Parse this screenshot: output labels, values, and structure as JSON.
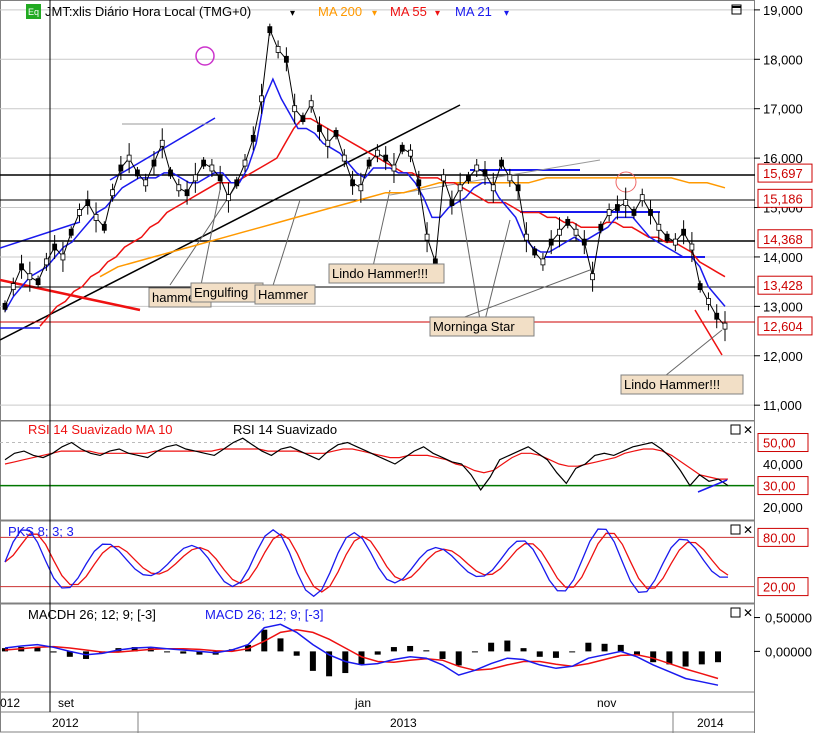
{
  "header": {
    "badge": "Eq",
    "symbol": "JMT:xlis Diário Hora Local (TMG+0)",
    "ma200": "MA 200",
    "ma55": "MA 55",
    "ma21": "MA 21",
    "caret": "▾"
  },
  "colors": {
    "price": "#000000",
    "ma200": "#ff9900",
    "ma55": "#ee1111",
    "ma21": "#1a1aee",
    "grid": "#c9c9c9",
    "badge": "#22aa22",
    "label_bg": "#f2dfc6",
    "line30": "#007700"
  },
  "annotations": {
    "hammer1": "hammer",
    "engulfing": "Engulfing",
    "hammer2": "Hammer",
    "lindo1": "Lindo Hammer!!!",
    "morninga": "Morninga Star",
    "lindo2": "Lindo Hammer!!!"
  },
  "rsi_panel": {
    "title1": "RSI 14 Suavizado MA 10",
    "title2": "RSI 14 Suavizado",
    "ticks": [
      "50,00",
      "40,000",
      "30,00",
      "20,000"
    ]
  },
  "pks_panel": {
    "title": "PKS 8; 3; 3",
    "ticks": [
      "80,00",
      "20,00"
    ]
  },
  "macd_panel": {
    "title1": "MACDH 26; 12; 9; [-3]",
    "title2": "MACD 26; 12; 9; [-3]",
    "ticks": [
      "0,50000",
      "0,00000"
    ]
  },
  "x_axis": {
    "top": [
      "012",
      "set",
      "jan",
      "nov"
    ],
    "bottom": [
      "2012",
      "2013",
      "2014"
    ]
  },
  "panel_icons": [
    "close-icon",
    "maximize-icon"
  ],
  "chart_data": {
    "type": "line",
    "title": "JMT:xlis Diário Hora Local (TMG+0)",
    "price_axis": {
      "ticks": [
        "19,000",
        "18,000",
        "17,000",
        "16,000",
        "15,000",
        "14,000",
        "13,000",
        "12,000",
        "11,000"
      ],
      "ylim": [
        10.7,
        19.2
      ],
      "marked_levels": [
        "15,697",
        "15,186",
        "14,368",
        "13,428",
        "12,604"
      ]
    },
    "x_labels": [
      "set",
      "jan",
      "nov"
    ],
    "year_labels": [
      "2012",
      "2013",
      "2014"
    ],
    "price_series": [
      {
        "name": "price",
        "values": [
          13.0,
          13.4,
          13.8,
          13.6,
          13.5,
          13.9,
          14.2,
          14.0,
          14.5,
          14.9,
          15.1,
          14.8,
          14.6,
          15.3,
          15.8,
          16.0,
          15.7,
          15.5,
          15.9,
          16.3,
          15.7,
          15.4,
          15.3,
          15.6,
          15.9,
          15.8,
          15.6,
          15.2,
          15.5,
          15.9,
          16.4,
          17.2,
          18.6,
          18.2,
          18.0,
          17.0,
          16.8,
          17.1,
          16.6,
          16.3,
          16.5,
          16.0,
          15.5,
          15.4,
          15.9,
          16.1,
          16.0,
          15.8,
          16.2,
          16.1,
          15.5,
          14.4,
          13.9,
          15.6,
          15.1,
          15.4,
          15.6,
          15.8,
          15.7,
          15.4,
          15.9,
          15.6,
          15.4,
          14.4,
          14.1,
          13.9,
          14.3,
          14.5,
          14.7,
          14.5,
          14.3,
          13.6,
          14.6,
          14.9,
          15.0,
          15.1,
          14.9,
          15.2,
          14.9,
          14.6,
          14.4,
          14.3,
          14.5,
          14.2,
          13.4,
          13.1,
          12.8,
          12.6
        ]
      },
      {
        "name": "MA 21",
        "values": [
          12.9,
          13.2,
          13.4,
          13.6,
          13.7,
          13.8,
          14.0,
          14.2,
          14.3,
          14.5,
          14.7,
          14.9,
          15.0,
          15.2,
          15.4,
          15.5,
          15.6,
          15.6,
          15.6,
          15.7,
          15.7,
          15.6,
          15.5,
          15.5,
          15.6,
          15.7,
          15.7,
          15.5,
          15.5,
          15.8,
          16.3,
          17.2,
          17.6,
          17.2,
          16.9,
          16.6,
          16.6,
          16.5,
          16.3,
          16.2,
          16.1,
          15.9,
          15.7,
          15.6,
          15.8,
          15.8,
          15.8,
          15.7,
          15.7,
          15.5,
          15.2,
          14.8,
          14.8,
          15.0,
          15.1,
          15.2,
          15.4,
          15.5,
          15.5,
          15.2,
          15.0,
          14.8,
          14.4,
          14.2,
          14.1,
          14.1,
          14.2,
          14.3,
          14.4,
          14.3,
          14.4,
          14.5,
          14.6,
          14.8,
          14.8,
          14.8,
          14.6,
          14.4,
          14.3,
          14.2,
          14.1,
          14.0,
          14.0,
          13.8,
          13.4,
          13.2,
          13.0
        ]
      },
      {
        "name": "MA 55",
        "values": [
          12.6,
          12.8,
          13.0,
          13.1,
          13.3,
          13.4,
          13.6,
          13.7,
          13.9,
          14.0,
          14.2,
          14.3,
          14.4,
          14.6,
          14.7,
          14.9,
          15.0,
          15.1,
          15.2,
          15.3,
          15.4,
          15.5,
          15.5,
          15.5,
          15.6,
          15.7,
          15.8,
          15.9,
          16.0,
          16.3,
          16.6,
          16.8,
          16.8,
          16.7,
          16.6,
          16.5,
          16.4,
          16.3,
          16.2,
          16.1,
          16.0,
          15.9,
          15.8,
          15.7,
          15.7,
          15.6,
          15.6,
          15.6,
          15.5,
          15.5,
          15.4,
          15.3,
          15.2,
          15.1,
          15.1,
          15.1,
          15.0,
          14.9,
          14.9,
          14.9,
          14.8,
          14.8,
          14.7,
          14.7,
          14.6,
          14.6,
          14.6,
          14.7,
          14.7,
          14.6,
          14.6,
          14.5,
          14.4,
          14.4,
          14.3,
          14.3,
          14.2,
          14.1,
          13.9,
          13.8,
          13.7,
          13.6
        ]
      },
      {
        "name": "MA 200",
        "values": [
          13.6,
          13.8,
          13.9,
          14.0,
          14.1,
          14.2,
          14.3,
          14.4,
          14.5,
          14.6,
          14.7,
          14.8,
          14.9,
          15.0,
          15.1,
          15.2,
          15.3,
          15.3,
          15.4,
          15.5,
          15.5,
          15.5,
          15.5,
          15.5,
          15.5,
          15.6,
          15.6,
          15.6,
          15.6,
          15.6,
          15.6,
          15.6,
          15.6,
          15.5,
          15.5,
          15.4
        ]
      }
    ],
    "rsi_series": [
      {
        "name": "RSI 14 Suavizado",
        "values": [
          42,
          45,
          46,
          44,
          43,
          45,
          48,
          50,
          47,
          45,
          44,
          46,
          47,
          45,
          44,
          43,
          46,
          48,
          49,
          47,
          46,
          45,
          44,
          47,
          50,
          52,
          49,
          46,
          44,
          47,
          48,
          46,
          44,
          42,
          46,
          49,
          50,
          48,
          46,
          44,
          42,
          40,
          43,
          46,
          48,
          45,
          43,
          41,
          40,
          35,
          28,
          34,
          42,
          44,
          46,
          48,
          45,
          42,
          36,
          31,
          38,
          40,
          44,
          45,
          44,
          46,
          48,
          49,
          50,
          47,
          43,
          37,
          30,
          35,
          32,
          33,
          30
        ]
      },
      {
        "name": "RSI 14 Suavizado MA 10",
        "values": [
          40,
          41,
          42,
          43,
          44,
          45,
          46,
          46,
          46,
          46,
          45,
          45,
          45,
          45,
          45,
          45,
          46,
          46,
          46,
          46,
          46,
          46,
          46,
          47,
          47,
          47,
          47,
          47,
          46,
          46,
          46,
          46,
          45,
          45,
          45,
          46,
          47,
          47,
          46,
          45,
          44,
          43,
          43,
          44,
          44,
          44,
          43,
          42,
          40,
          39,
          37,
          36,
          37,
          40,
          43,
          45,
          45,
          44,
          42,
          40,
          39,
          39,
          40,
          41,
          42,
          43,
          45,
          46,
          47,
          47,
          46,
          44,
          41,
          38,
          35,
          34,
          33,
          33
        ]
      }
    ],
    "rsi_reference_levels": [
      50,
      30
    ],
    "pks_reference_levels": [
      80,
      20
    ],
    "macd_series": [
      {
        "name": "MACD",
        "values": [
          0.05,
          0.08,
          0.1,
          0.06,
          0.0,
          -0.05,
          -0.03,
          0.02,
          0.05,
          0.06,
          0.04,
          0.02,
          0.0,
          -0.02,
          0.02,
          0.1,
          0.35,
          0.4,
          0.28,
          0.1,
          -0.05,
          -0.15,
          -0.2,
          -0.18,
          -0.12,
          -0.08,
          -0.1,
          -0.2,
          -0.35,
          -0.28,
          -0.18,
          -0.1,
          -0.12,
          -0.2,
          -0.25,
          -0.22,
          -0.1,
          -0.05,
          0.0,
          -0.08,
          -0.2,
          -0.3,
          -0.4,
          -0.45,
          -0.5
        ]
      },
      {
        "name": "MACD signal",
        "values": [
          0.02,
          0.04,
          0.06,
          0.07,
          0.05,
          0.02,
          -0.01,
          -0.01,
          0.01,
          0.03,
          0.04,
          0.04,
          0.03,
          0.01,
          0.0,
          0.04,
          0.15,
          0.28,
          0.32,
          0.28,
          0.18,
          0.05,
          -0.08,
          -0.15,
          -0.16,
          -0.13,
          -0.11,
          -0.13,
          -0.22,
          -0.28,
          -0.26,
          -0.2,
          -0.15,
          -0.15,
          -0.19,
          -0.22,
          -0.18,
          -0.12,
          -0.06,
          -0.05,
          -0.1,
          -0.18,
          -0.26,
          -0.33,
          -0.4
        ]
      }
    ]
  }
}
